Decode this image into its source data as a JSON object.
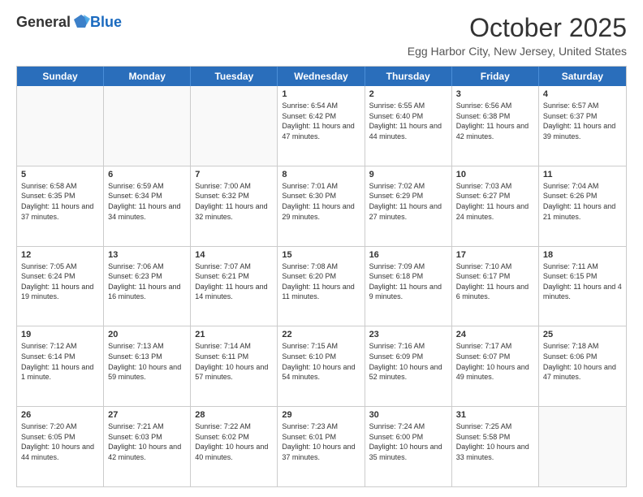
{
  "header": {
    "logo_general": "General",
    "logo_blue": "Blue",
    "month_title": "October 2025",
    "location": "Egg Harbor City, New Jersey, United States"
  },
  "days_of_week": [
    "Sunday",
    "Monday",
    "Tuesday",
    "Wednesday",
    "Thursday",
    "Friday",
    "Saturday"
  ],
  "weeks": [
    [
      {
        "day": "",
        "empty": true
      },
      {
        "day": "",
        "empty": true
      },
      {
        "day": "",
        "empty": true
      },
      {
        "day": "1",
        "sunrise": "6:54 AM",
        "sunset": "6:42 PM",
        "daylight": "11 hours and 47 minutes."
      },
      {
        "day": "2",
        "sunrise": "6:55 AM",
        "sunset": "6:40 PM",
        "daylight": "11 hours and 44 minutes."
      },
      {
        "day": "3",
        "sunrise": "6:56 AM",
        "sunset": "6:38 PM",
        "daylight": "11 hours and 42 minutes."
      },
      {
        "day": "4",
        "sunrise": "6:57 AM",
        "sunset": "6:37 PM",
        "daylight": "11 hours and 39 minutes."
      }
    ],
    [
      {
        "day": "5",
        "sunrise": "6:58 AM",
        "sunset": "6:35 PM",
        "daylight": "11 hours and 37 minutes."
      },
      {
        "day": "6",
        "sunrise": "6:59 AM",
        "sunset": "6:34 PM",
        "daylight": "11 hours and 34 minutes."
      },
      {
        "day": "7",
        "sunrise": "7:00 AM",
        "sunset": "6:32 PM",
        "daylight": "11 hours and 32 minutes."
      },
      {
        "day": "8",
        "sunrise": "7:01 AM",
        "sunset": "6:30 PM",
        "daylight": "11 hours and 29 minutes."
      },
      {
        "day": "9",
        "sunrise": "7:02 AM",
        "sunset": "6:29 PM",
        "daylight": "11 hours and 27 minutes."
      },
      {
        "day": "10",
        "sunrise": "7:03 AM",
        "sunset": "6:27 PM",
        "daylight": "11 hours and 24 minutes."
      },
      {
        "day": "11",
        "sunrise": "7:04 AM",
        "sunset": "6:26 PM",
        "daylight": "11 hours and 21 minutes."
      }
    ],
    [
      {
        "day": "12",
        "sunrise": "7:05 AM",
        "sunset": "6:24 PM",
        "daylight": "11 hours and 19 minutes."
      },
      {
        "day": "13",
        "sunrise": "7:06 AM",
        "sunset": "6:23 PM",
        "daylight": "11 hours and 16 minutes."
      },
      {
        "day": "14",
        "sunrise": "7:07 AM",
        "sunset": "6:21 PM",
        "daylight": "11 hours and 14 minutes."
      },
      {
        "day": "15",
        "sunrise": "7:08 AM",
        "sunset": "6:20 PM",
        "daylight": "11 hours and 11 minutes."
      },
      {
        "day": "16",
        "sunrise": "7:09 AM",
        "sunset": "6:18 PM",
        "daylight": "11 hours and 9 minutes."
      },
      {
        "day": "17",
        "sunrise": "7:10 AM",
        "sunset": "6:17 PM",
        "daylight": "11 hours and 6 minutes."
      },
      {
        "day": "18",
        "sunrise": "7:11 AM",
        "sunset": "6:15 PM",
        "daylight": "11 hours and 4 minutes."
      }
    ],
    [
      {
        "day": "19",
        "sunrise": "7:12 AM",
        "sunset": "6:14 PM",
        "daylight": "11 hours and 1 minute."
      },
      {
        "day": "20",
        "sunrise": "7:13 AM",
        "sunset": "6:13 PM",
        "daylight": "10 hours and 59 minutes."
      },
      {
        "day": "21",
        "sunrise": "7:14 AM",
        "sunset": "6:11 PM",
        "daylight": "10 hours and 57 minutes."
      },
      {
        "day": "22",
        "sunrise": "7:15 AM",
        "sunset": "6:10 PM",
        "daylight": "10 hours and 54 minutes."
      },
      {
        "day": "23",
        "sunrise": "7:16 AM",
        "sunset": "6:09 PM",
        "daylight": "10 hours and 52 minutes."
      },
      {
        "day": "24",
        "sunrise": "7:17 AM",
        "sunset": "6:07 PM",
        "daylight": "10 hours and 49 minutes."
      },
      {
        "day": "25",
        "sunrise": "7:18 AM",
        "sunset": "6:06 PM",
        "daylight": "10 hours and 47 minutes."
      }
    ],
    [
      {
        "day": "26",
        "sunrise": "7:20 AM",
        "sunset": "6:05 PM",
        "daylight": "10 hours and 44 minutes."
      },
      {
        "day": "27",
        "sunrise": "7:21 AM",
        "sunset": "6:03 PM",
        "daylight": "10 hours and 42 minutes."
      },
      {
        "day": "28",
        "sunrise": "7:22 AM",
        "sunset": "6:02 PM",
        "daylight": "10 hours and 40 minutes."
      },
      {
        "day": "29",
        "sunrise": "7:23 AM",
        "sunset": "6:01 PM",
        "daylight": "10 hours and 37 minutes."
      },
      {
        "day": "30",
        "sunrise": "7:24 AM",
        "sunset": "6:00 PM",
        "daylight": "10 hours and 35 minutes."
      },
      {
        "day": "31",
        "sunrise": "7:25 AM",
        "sunset": "5:58 PM",
        "daylight": "10 hours and 33 minutes."
      },
      {
        "day": "",
        "empty": true
      }
    ]
  ]
}
